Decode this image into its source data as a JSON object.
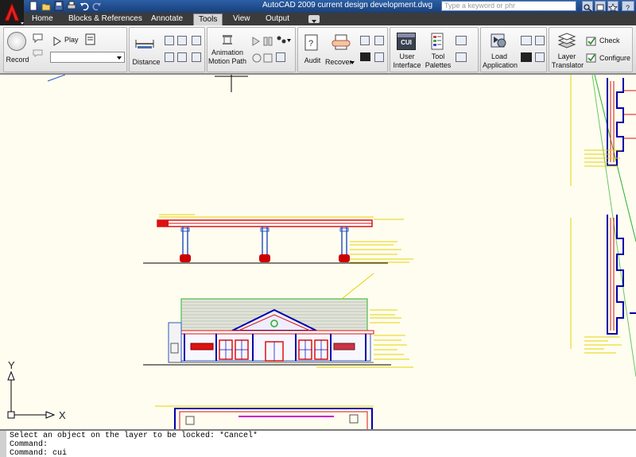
{
  "window": {
    "title": "AutoCAD 2009  current design development.dwg",
    "search_placeholder": "Type a keyword or phr"
  },
  "tabs": [
    {
      "label": "Home"
    },
    {
      "label": "Blocks & References"
    },
    {
      "label": "Annotate"
    },
    {
      "label": "Tools"
    },
    {
      "label": "View"
    },
    {
      "label": "Output"
    }
  ],
  "active_tab": "Tools",
  "ribbon": {
    "record_label": "Record",
    "play_label": "Play",
    "distance_label": "Distance",
    "animation_label_1": "Animation",
    "animation_label_2": "Motion Path",
    "audit_label": "Audit",
    "recover_label": "Recover",
    "user_interface_label_1": "User",
    "user_interface_label_2": "Interface",
    "cui_icon_text": "CUI",
    "tool_palettes_label_1": "Tool",
    "tool_palettes_label_2": "Palettes",
    "load_application_label_1": "Load",
    "load_application_label_2": "Application",
    "layer_translator_label_1": "Layer",
    "layer_translator_label_2": "Translator",
    "check_label": "Check",
    "configure_label": "Configure"
  },
  "ucs": {
    "x_label": "X",
    "y_label": "Y"
  },
  "command_line": [
    "Select an object on the layer to be locked: *Cancel*",
    "Command:",
    "Command:  cui"
  ],
  "colors": {
    "canvas": "#fffdf0",
    "ribbon": "#e4e4e4",
    "tabbar": "#3b3b3b",
    "titlebar": "#1a3f78"
  }
}
